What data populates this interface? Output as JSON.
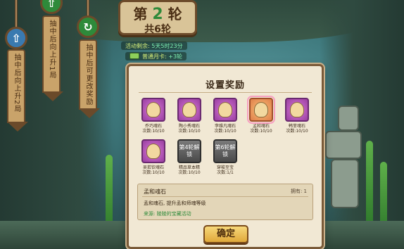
{
  "round": {
    "prefix": "第",
    "number": "2",
    "suffix": "轮",
    "total": "共6轮"
  },
  "info": {
    "remaining_label": "活动剩余:",
    "remaining_value": "5天5时23分",
    "monthcard_label": "普通月卡:",
    "monthcard_value": "+3轮"
  },
  "hangers": [
    {
      "icon": "up-arrow-icon",
      "text": "抽中后向上升2局",
      "color": "#3a7ab0"
    },
    {
      "icon": "up-arrow-icon",
      "text": "抽中后向上升1局",
      "color": "#2e8a3a"
    },
    {
      "icon": "refresh-icon",
      "text": "抽中后可更改奖励",
      "color": "#2e8a3a"
    }
  ],
  "dialog": {
    "title": "设置奖励",
    "rewards": [
      {
        "name": "乔巧魂石",
        "count": "次数:10/10",
        "style": "purple"
      },
      {
        "name": "陶小秀魂石",
        "count": "次数:10/10",
        "style": "purple"
      },
      {
        "name": "李维凡魂石",
        "count": "次数:10/10",
        "style": "purple"
      },
      {
        "name": "孟和魂石",
        "count": "次数:10/10",
        "style": "gold"
      },
      {
        "name": "韩菲魂石",
        "count": "次数:10/10",
        "style": "purple"
      },
      {
        "name": "吴若钦魂石",
        "count": "次数:10/10",
        "style": "purple"
      },
      {
        "name": "精品草本精",
        "count": "次数:10/10",
        "style": "locked",
        "lock": "第4轮解锁"
      },
      {
        "name": "穿梭至宝",
        "count": "次数:1/1",
        "style": "locked",
        "lock": "第6轮解锁"
      }
    ],
    "detail": {
      "name": "孟和魂石",
      "owned": "拥有: 1",
      "desc": "孟和魂石, 提升孟和师魂等级",
      "source": "来源: 陵陵的宝藏活动"
    },
    "confirm": "确定"
  }
}
